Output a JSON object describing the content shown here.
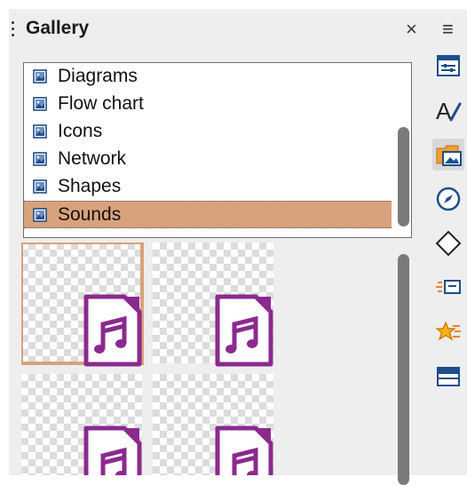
{
  "panel": {
    "title": "Gallery",
    "close_glyph": "×"
  },
  "themes": [
    {
      "label": "Diagrams",
      "icon": "theme-icon",
      "selected": false
    },
    {
      "label": "Flow chart",
      "icon": "theme-icon",
      "selected": false
    },
    {
      "label": "Icons",
      "icon": "theme-icon",
      "selected": false
    },
    {
      "label": "Network",
      "icon": "theme-icon",
      "selected": false
    },
    {
      "label": "Shapes",
      "icon": "theme-icon",
      "selected": false
    },
    {
      "label": "Sounds",
      "icon": "theme-icon",
      "selected": true
    }
  ],
  "gallery_items": [
    {
      "icon": "audio-file-icon",
      "selected": true
    },
    {
      "icon": "audio-file-icon",
      "selected": false
    },
    {
      "icon": "audio-file-icon",
      "selected": false
    },
    {
      "icon": "audio-file-icon",
      "selected": false
    }
  ],
  "deck": {
    "menu_glyph": "≡",
    "buttons": [
      {
        "icon": "properties-icon",
        "active": false
      },
      {
        "icon": "styles-icon",
        "active": false
      },
      {
        "icon": "gallery-icon",
        "active": true
      },
      {
        "icon": "navigator-icon",
        "active": false
      },
      {
        "icon": "shapes-icon",
        "active": false
      },
      {
        "icon": "slide-transition-icon",
        "active": false
      },
      {
        "icon": "animation-icon",
        "active": false
      },
      {
        "icon": "master-slides-icon",
        "active": false
      }
    ]
  },
  "colors": {
    "selection": "#d8a27c",
    "accent_purple": "#8b2a8e",
    "panel_bg": "#eeeeee"
  }
}
